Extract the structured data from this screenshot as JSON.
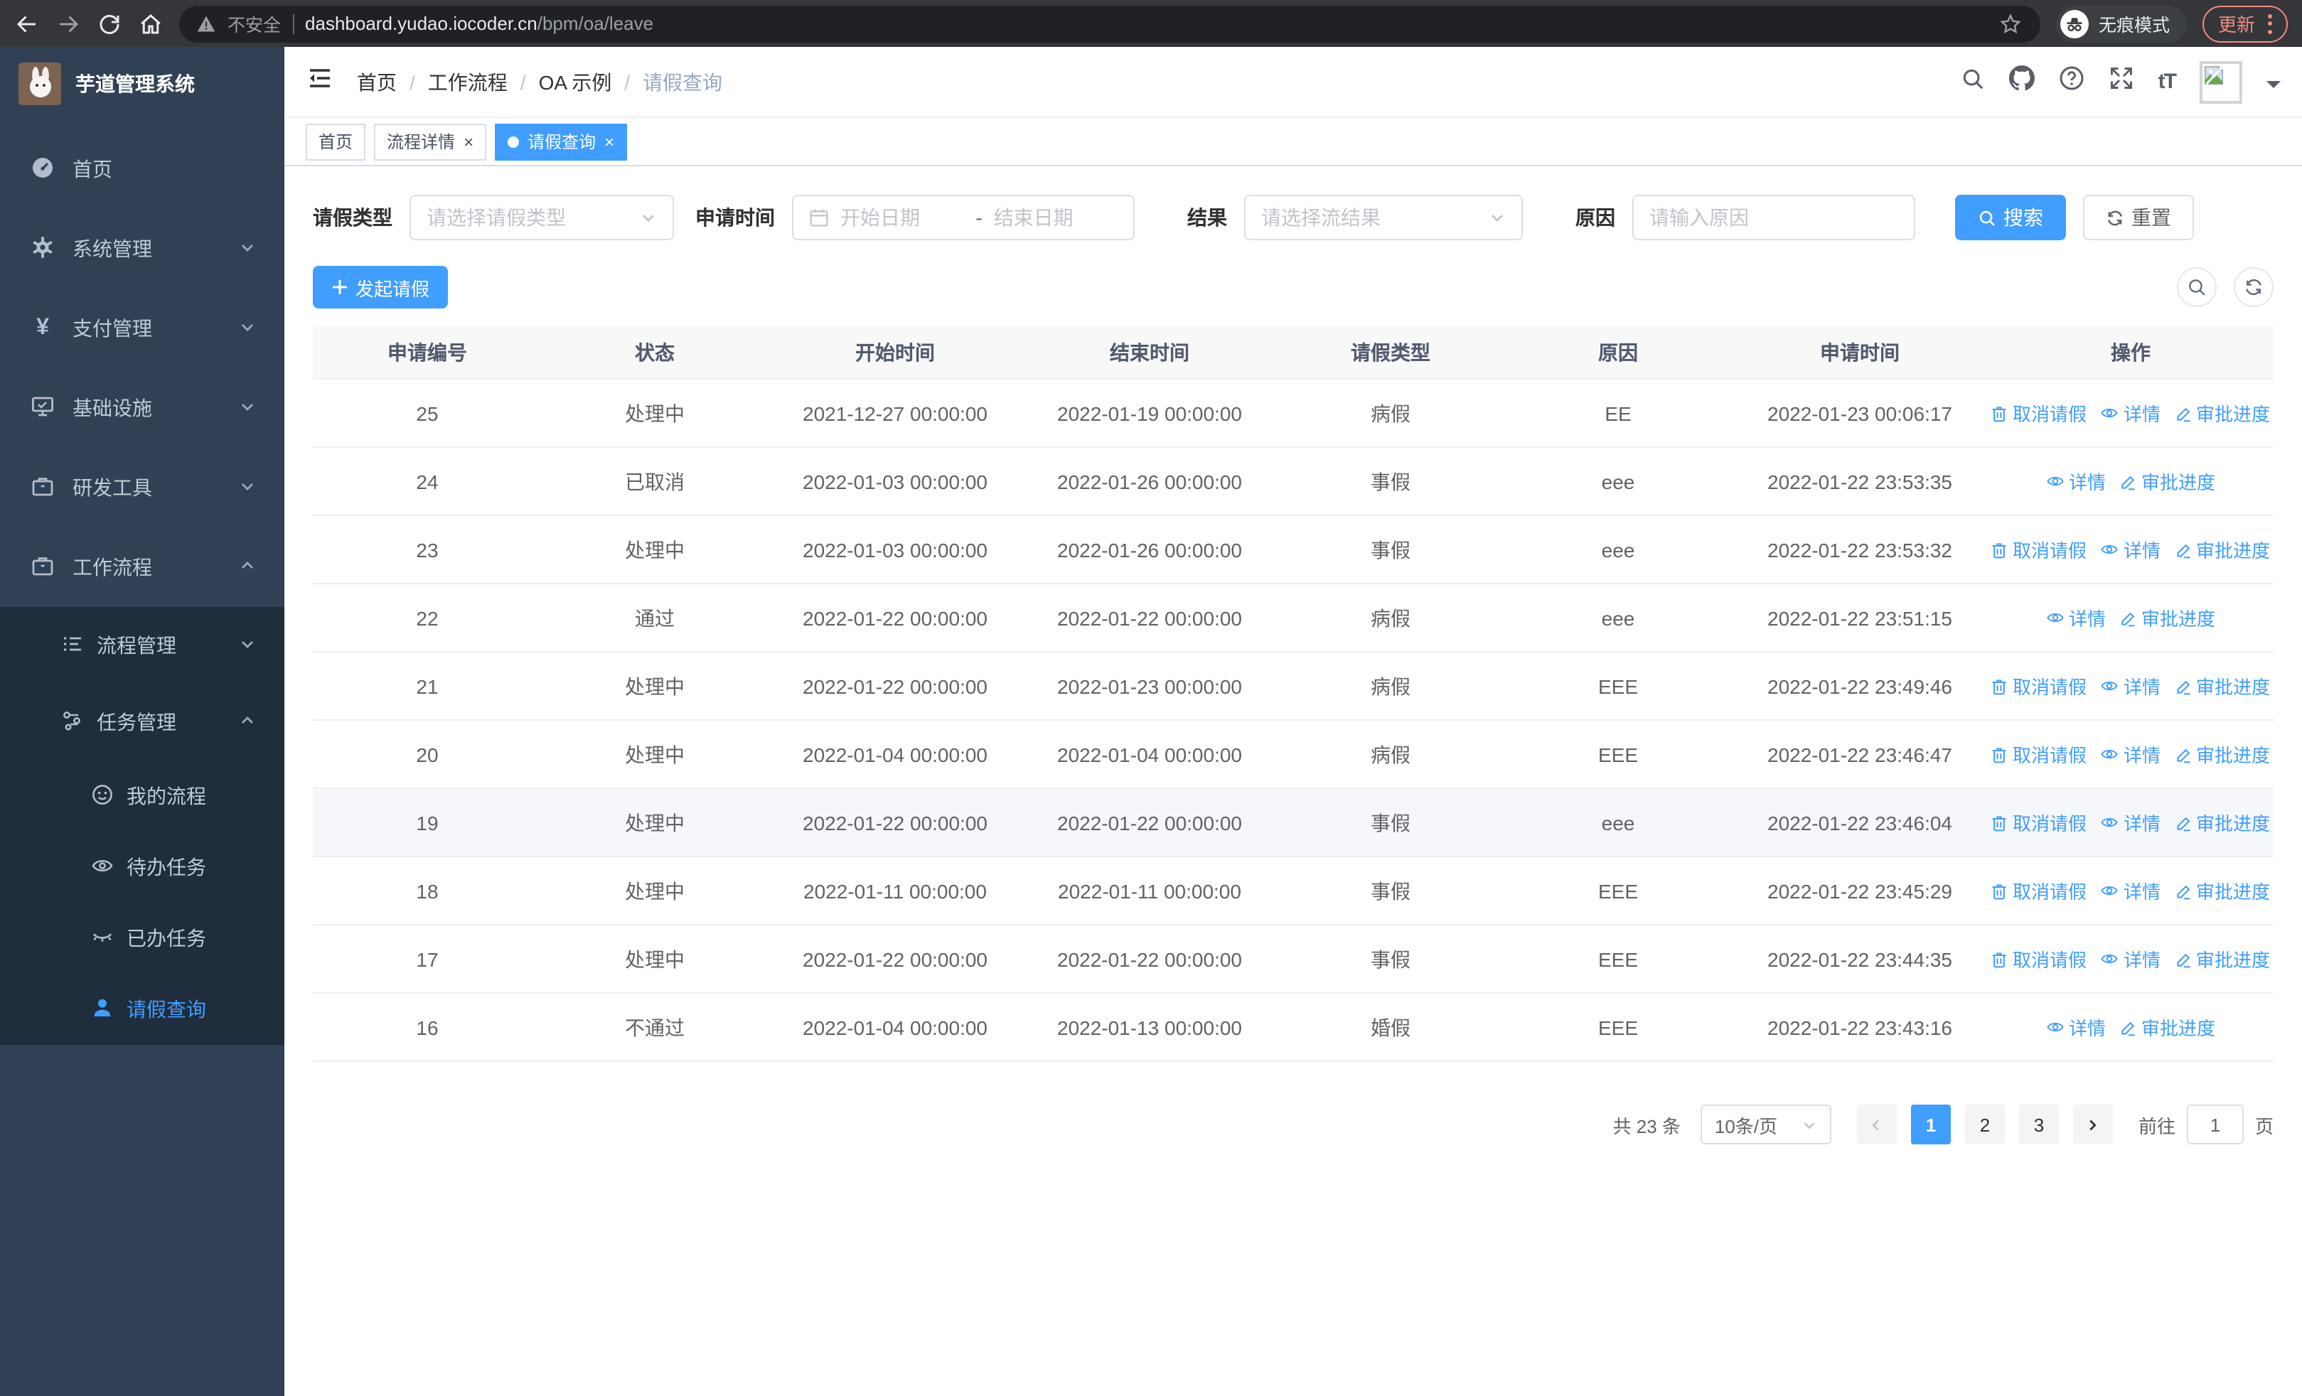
{
  "browser": {
    "not_secure_label": "不安全",
    "url_domain": "dashboard.yudao.iocoder.cn",
    "url_path": "/bpm/oa/leave",
    "incognito_label": "无痕模式",
    "update_label": "更新"
  },
  "sidebar": {
    "title": "芋道管理系统",
    "home": "首页",
    "system": "系统管理",
    "pay": "支付管理",
    "infra": "基础设施",
    "devtools": "研发工具",
    "workflow": "工作流程",
    "process_mgmt": "流程管理",
    "task_mgmt": "任务管理",
    "my_process": "我的流程",
    "todo_tasks": "待办任务",
    "done_tasks": "已办任务",
    "leave_query": "请假查询"
  },
  "breadcrumb": {
    "items": [
      {
        "label": "首页"
      },
      {
        "label": "工作流程"
      },
      {
        "label": "OA 示例"
      },
      {
        "label": "请假查询"
      }
    ]
  },
  "tags": [
    {
      "label": "首页"
    },
    {
      "label": "流程详情",
      "closable": true
    },
    {
      "label": "请假查询",
      "closable": true,
      "active": true
    }
  ],
  "filters": {
    "leave_type_label": "请假类型",
    "leave_type_placeholder": "请选择请假类型",
    "apply_time_label": "申请时间",
    "date_start_placeholder": "开始日期",
    "date_separator": "-",
    "date_end_placeholder": "结束日期",
    "result_label": "结果",
    "result_placeholder": "请选择流结果",
    "reason_label": "原因",
    "reason_placeholder": "请输入原因",
    "search_label": "搜索",
    "reset_label": "重置"
  },
  "toolbar": {
    "create_label": "发起请假"
  },
  "table": {
    "columns": [
      "申请编号",
      "状态",
      "开始时间",
      "结束时间",
      "请假类型",
      "原因",
      "申请时间",
      "操作"
    ],
    "actions": {
      "cancel": "取消请假",
      "detail": "详情",
      "progress": "审批进度"
    },
    "rows": [
      {
        "id": "25",
        "status": "处理中",
        "start": "2021-12-27 00:00:00",
        "end": "2022-01-19 00:00:00",
        "type": "病假",
        "reason": "EE",
        "apply_time": "2022-01-23 00:06:17",
        "can_cancel": true
      },
      {
        "id": "24",
        "status": "已取消",
        "start": "2022-01-03 00:00:00",
        "end": "2022-01-26 00:00:00",
        "type": "事假",
        "reason": "eee",
        "apply_time": "2022-01-22 23:53:35",
        "can_cancel": false
      },
      {
        "id": "23",
        "status": "处理中",
        "start": "2022-01-03 00:00:00",
        "end": "2022-01-26 00:00:00",
        "type": "事假",
        "reason": "eee",
        "apply_time": "2022-01-22 23:53:32",
        "can_cancel": true
      },
      {
        "id": "22",
        "status": "通过",
        "start": "2022-01-22 00:00:00",
        "end": "2022-01-22 00:00:00",
        "type": "病假",
        "reason": "eee",
        "apply_time": "2022-01-22 23:51:15",
        "can_cancel": false
      },
      {
        "id": "21",
        "status": "处理中",
        "start": "2022-01-22 00:00:00",
        "end": "2022-01-23 00:00:00",
        "type": "病假",
        "reason": "EEE",
        "apply_time": "2022-01-22 23:49:46",
        "can_cancel": true
      },
      {
        "id": "20",
        "status": "处理中",
        "start": "2022-01-04 00:00:00",
        "end": "2022-01-04 00:00:00",
        "type": "病假",
        "reason": "EEE",
        "apply_time": "2022-01-22 23:46:47",
        "can_cancel": true
      },
      {
        "id": "19",
        "status": "处理中",
        "start": "2022-01-22 00:00:00",
        "end": "2022-01-22 00:00:00",
        "type": "事假",
        "reason": "eee",
        "apply_time": "2022-01-22 23:46:04",
        "can_cancel": true,
        "highlight": true
      },
      {
        "id": "18",
        "status": "处理中",
        "start": "2022-01-11 00:00:00",
        "end": "2022-01-11 00:00:00",
        "type": "事假",
        "reason": "EEE",
        "apply_time": "2022-01-22 23:45:29",
        "can_cancel": true
      },
      {
        "id": "17",
        "status": "处理中",
        "start": "2022-01-22 00:00:00",
        "end": "2022-01-22 00:00:00",
        "type": "事假",
        "reason": "EEE",
        "apply_time": "2022-01-22 23:44:35",
        "can_cancel": true
      },
      {
        "id": "16",
        "status": "不通过",
        "start": "2022-01-04 00:00:00",
        "end": "2022-01-13 00:00:00",
        "type": "婚假",
        "reason": "EEE",
        "apply_time": "2022-01-22 23:43:16",
        "can_cancel": false
      }
    ]
  },
  "pagination": {
    "total_label": "共 23 条",
    "page_size_label": "10条/页",
    "pages": [
      {
        "label": "1",
        "active": true
      },
      {
        "label": "2"
      },
      {
        "label": "3"
      }
    ],
    "goto_label": "前往",
    "goto_value": "1",
    "page_unit_label": "页"
  },
  "colors": {
    "accent": "#409eff",
    "sidebar_bg": "#304156",
    "submenu_bg": "#1f2d3d",
    "update_accent": "#f28b82"
  },
  "icons": {
    "back": "left-arrow",
    "forward": "right-arrow",
    "reload": "circular-arrow",
    "home": "house",
    "warning": "triangle-exclamation",
    "bookmark": "star",
    "incognito": "hat-and-glasses",
    "menu_fold": "hamburger-with-arrow",
    "search": "magnifier",
    "github": "octocat",
    "help": "question-circle",
    "fullscreen": "expand-arrows",
    "font_size": "tT",
    "dashboard": "gauge",
    "system": "gear",
    "pay": "yen-sign",
    "infra": "monitor",
    "devtools": "briefcase",
    "workflow": "briefcase",
    "process": "tree-list",
    "task": "flow-nodes",
    "my_process": "smiley-face",
    "todo": "eye-open",
    "done": "eye-closed",
    "user": "person",
    "calendar": "calendar",
    "cancel": "trash",
    "detail": "eye",
    "progress": "pen",
    "refresh": "refresh-arrows",
    "plus": "plus"
  }
}
